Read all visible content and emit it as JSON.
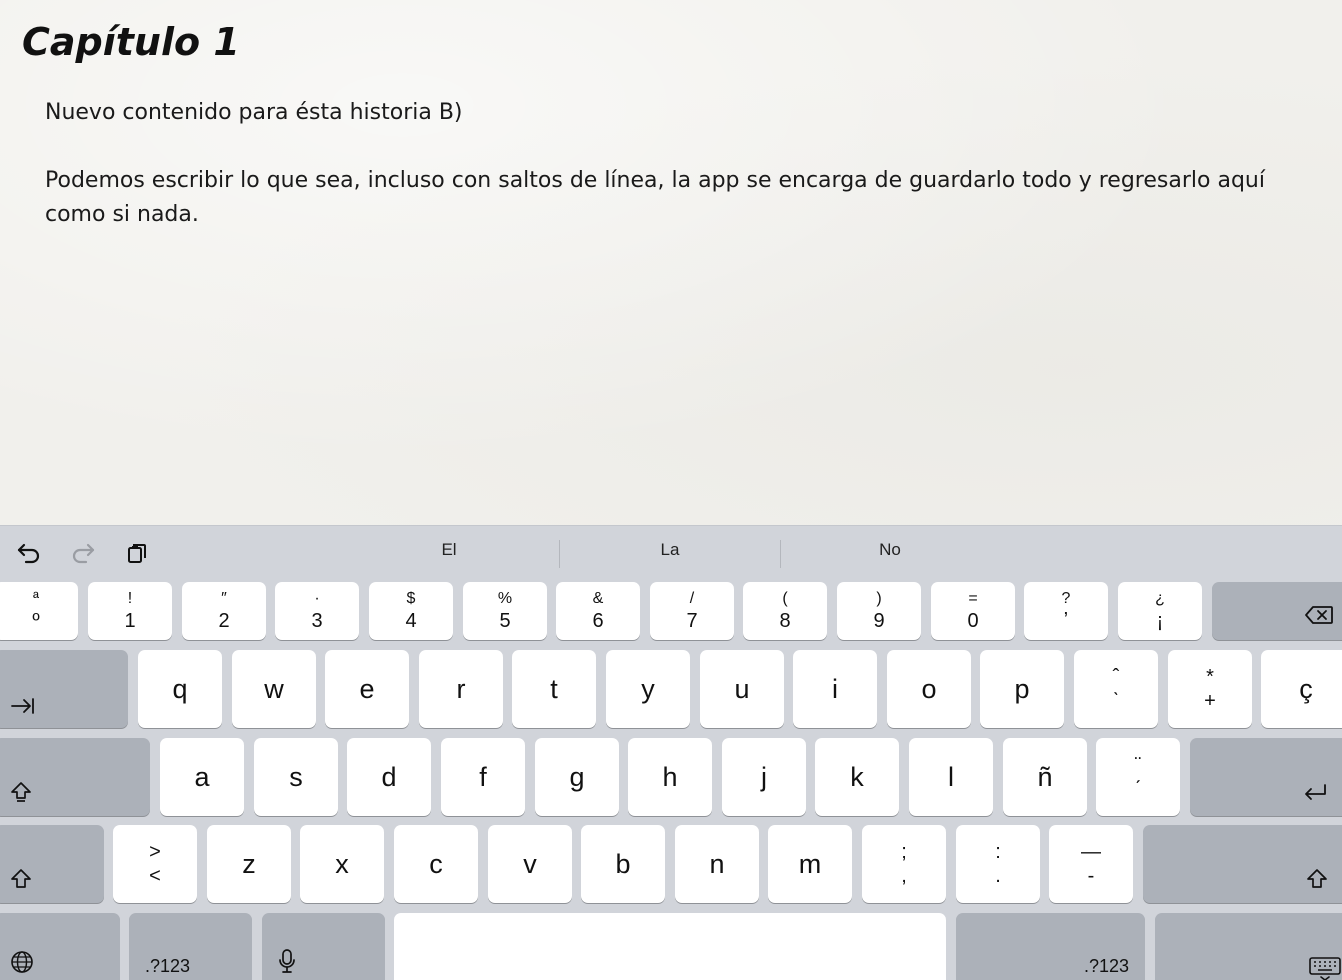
{
  "document": {
    "title": "Capítulo 1",
    "paragraphs": [
      "Nuevo contenido para ésta historia B)",
      "Podemos escribir lo que sea, incluso con saltos de línea, la app se encarga de guardarlo todo y regresarlo aquí como si nada."
    ]
  },
  "keyboard": {
    "tools": {
      "undo": "undo-icon",
      "redo": "redo-icon",
      "paste": "paste-icon"
    },
    "suggestions": [
      "El",
      "La",
      "No"
    ],
    "number_row": [
      {
        "top": "ª",
        "bottom": "º"
      },
      {
        "top": "!",
        "bottom": "1"
      },
      {
        "top": "″",
        "bottom": "2"
      },
      {
        "top": "·",
        "bottom": "3"
      },
      {
        "top": "$",
        "bottom": "4"
      },
      {
        "top": "%",
        "bottom": "5"
      },
      {
        "top": "&",
        "bottom": "6"
      },
      {
        "top": "/",
        "bottom": "7"
      },
      {
        "top": "(",
        "bottom": "8"
      },
      {
        "top": ")",
        "bottom": "9"
      },
      {
        "top": "=",
        "bottom": "0"
      },
      {
        "top": "?",
        "bottom": "ʼ"
      },
      {
        "top": "¿",
        "bottom": "¡"
      }
    ],
    "row_q": [
      "q",
      "w",
      "e",
      "r",
      "t",
      "y",
      "u",
      "i",
      "o",
      "p"
    ],
    "row_q_extra": [
      {
        "top": "ˆ",
        "bottom": "ˋ"
      },
      {
        "top": "*",
        "bottom": "+"
      },
      {
        "single": "ç"
      }
    ],
    "row_a": [
      "a",
      "s",
      "d",
      "f",
      "g",
      "h",
      "j",
      "k",
      "l",
      "ñ"
    ],
    "row_a_extra": {
      "top": "¨",
      "bottom": "ˊ"
    },
    "row_z_first": {
      "top": ">",
      "bottom": "<"
    },
    "row_z": [
      "z",
      "x",
      "c",
      "v",
      "b",
      "n",
      "m"
    ],
    "row_z_extra": [
      {
        "top": ";",
        "bottom": ","
      },
      {
        "top": ":",
        "bottom": "."
      },
      {
        "top": "—",
        "bottom": "-"
      }
    ],
    "numbers_label": ".?123",
    "icons": {
      "delete": "delete-icon",
      "tab": "tab-icon",
      "shift": "shift-icon",
      "return": "return-icon",
      "globe": "globe-icon",
      "mic": "microphone-icon",
      "hide": "hide-keyboard-icon"
    }
  }
}
